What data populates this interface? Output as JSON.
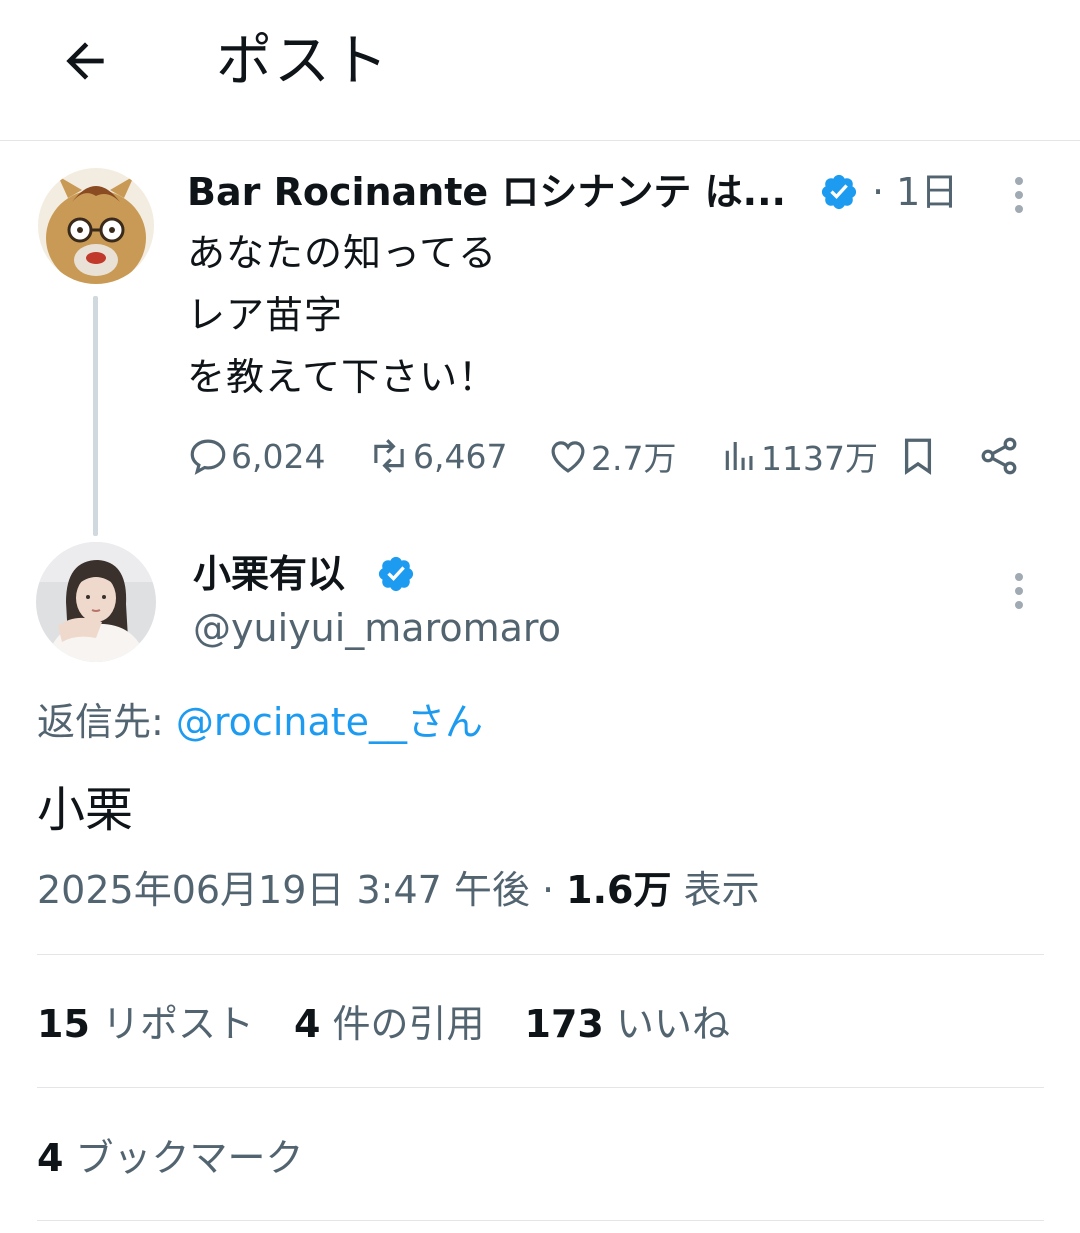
{
  "header": {
    "title": "ポスト",
    "back_icon": "arrow-left-icon"
  },
  "parent": {
    "name": "Bar Rocinante ロシナンテ は...",
    "time": "· 1日",
    "text_lines": [
      "あなたの知ってる",
      "レア苗字",
      "を教えて下さい！"
    ],
    "actions": {
      "replies": "6,024",
      "reposts": "6,467",
      "likes": "2.7万",
      "views": "1137万"
    }
  },
  "reply": {
    "name": "小栗有以",
    "handle": "@yuiyui_maromaro",
    "reply_to_label": "返信先: ",
    "reply_to_mention": "@rocinate__さん",
    "text": "小栗",
    "timestamp": "2025年06月19日 3:47 午後 · ",
    "views_count": "1.6万",
    "views_label": " 表示",
    "stats": {
      "reposts_count": "15",
      "reposts_label": " リポスト",
      "quotes_count": "4",
      "quotes_label": " 件の引用",
      "likes_count": "173",
      "likes_label": " いいね",
      "bookmarks_count": "4",
      "bookmarks_label": " ブックマーク"
    }
  },
  "colors": {
    "accent": "#1d9bf0",
    "secondary_text": "#536471",
    "primary_text": "#0f1419",
    "divider": "#e3e6e9"
  }
}
